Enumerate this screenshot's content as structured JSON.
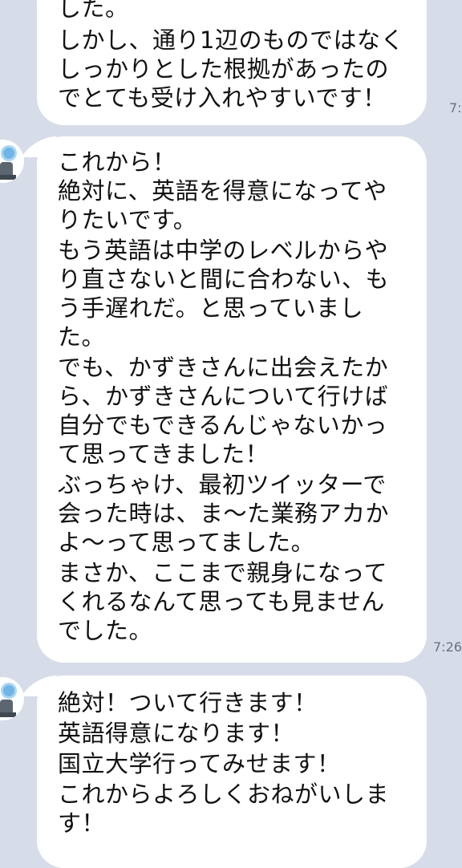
{
  "messages": [
    {
      "lines": [
        "した。",
        "しかし、通り1辺のものではなく",
        "しっかりとした根拠があったの",
        "でとても受け入れやすいです！"
      ],
      "time": "7:"
    },
    {
      "lines": [
        "これから！",
        "絶対に、英語を得意になってや",
        "りたいです。",
        "もう英語は中学のレベルからや",
        "り直さないと間に合わない、も",
        "う手遅れだ。と思っていまし",
        "た。",
        "でも、かずきさんに出会えたか",
        "ら、かずきさんについて行けば",
        "自分でもできるんじゃないかっ",
        "て思ってきました！",
        "ぶっちゃけ、最初ツイッターで",
        "会った時は、ま〜た業務アカか",
        "よ〜って思ってました。",
        "まさか、ここまで親身になって",
        "くれるなんて思っても見ません",
        "でした。"
      ],
      "time": "7:26"
    },
    {
      "lines": [
        "絶対！ついて行きます！",
        "英語得意になります！",
        "国立大学行ってみせます！",
        "これからよろしくおねがいしま",
        "す！"
      ]
    }
  ]
}
